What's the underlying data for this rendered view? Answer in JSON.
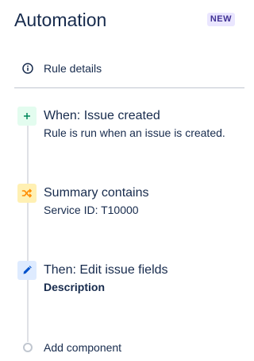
{
  "header": {
    "title": "Automation",
    "badge": "NEW"
  },
  "rule_details": {
    "icon": "info-icon",
    "label": "Rule details"
  },
  "steps": [
    {
      "kind": "trigger",
      "icon": "plus-icon",
      "icon_color": "#00875a",
      "icon_bg": "#e3fcef",
      "title": "When: Issue created",
      "description": "Rule is run when an issue is created."
    },
    {
      "kind": "condition",
      "icon": "shuffle-icon",
      "icon_color": "#ff8b00",
      "icon_bg": "#fff0b3",
      "title": "Summary contains",
      "description": "Service ID: T10000"
    },
    {
      "kind": "action",
      "icon": "pencil-icon",
      "icon_color": "#0052cc",
      "icon_bg": "#deebff",
      "title": "Then: Edit issue fields",
      "description": "Description"
    }
  ],
  "add_component": {
    "icon": "empty-circle-icon",
    "label": "Add component"
  },
  "colors": {
    "text": "#172b4d",
    "badge_bg": "#eae6ff",
    "badge_text": "#403294",
    "divider": "#c1c7d0",
    "timeline": "#dfe1e6"
  }
}
